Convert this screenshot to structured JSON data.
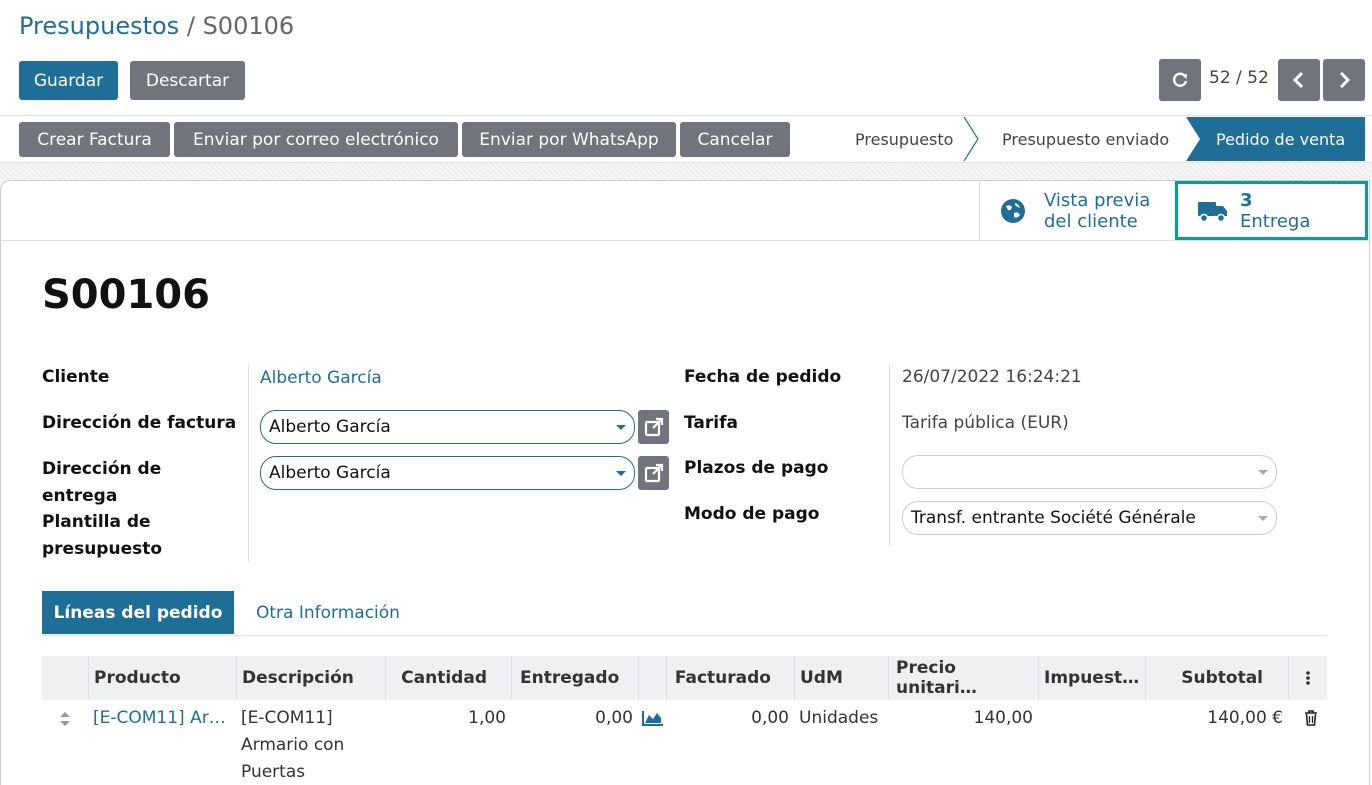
{
  "breadcrumb": {
    "parent": "Presupuestos",
    "separator": "/",
    "current": "S00106"
  },
  "actions": {
    "save": "Guardar",
    "discard": "Descartar"
  },
  "pager": {
    "text": "52 / 52"
  },
  "header_buttons": {
    "invoice": "Crear Factura",
    "email": "Enviar por correo electrónico",
    "whatsapp": "Enviar por WhatsApp",
    "cancel": "Cancelar"
  },
  "status": {
    "stages": [
      "Presupuesto",
      "Presupuesto enviado",
      "Pedido de venta"
    ],
    "active": "Pedido de venta"
  },
  "smart_buttons": {
    "preview_line1": "Vista previa",
    "preview_line2": "del cliente",
    "delivery_count": "3",
    "delivery_label": "Entrega"
  },
  "record": {
    "name": "S00106"
  },
  "fields": {
    "client_label": "Cliente",
    "client_value": "Alberto García",
    "invoice_address_label": "Dirección de factura",
    "invoice_address_value": "Alberto García",
    "delivery_address_label_1": "Dirección de",
    "delivery_address_label_2": "entrega",
    "delivery_address_value": "Alberto García",
    "template_label_1": "Plantilla de",
    "template_label_2": "presupuesto",
    "order_date_label": "Fecha de pedido",
    "order_date_value": "26/07/2022 16:24:21",
    "pricelist_label": "Tarifa",
    "pricelist_value": "Tarifa pública (EUR)",
    "payment_terms_label": "Plazos de pago",
    "payment_terms_value": "",
    "payment_mode_label": "Modo de pago",
    "payment_mode_value": "Transf. entrante Société Générale"
  },
  "tabs": {
    "lines": "Líneas del pedido",
    "other": "Otra Información"
  },
  "table": {
    "headers": {
      "product": "Producto",
      "description": "Descripción",
      "qty": "Cantidad",
      "delivered": "Entregado",
      "invoiced": "Facturado",
      "uom": "UdM",
      "unit_price": "Precio unitari…",
      "taxes": "Impuest…",
      "subtotal": "Subtotal"
    },
    "rows": [
      {
        "product": "[E-COM11] Ar…",
        "desc_1": "[E-COM11]",
        "desc_2": "Armario con",
        "desc_3": "Puertas",
        "qty": "1,00",
        "delivered": "0,00",
        "invoiced": "0,00",
        "uom": "Unidades",
        "unit_price": "140,00",
        "subtotal": "140,00 €"
      }
    ]
  }
}
